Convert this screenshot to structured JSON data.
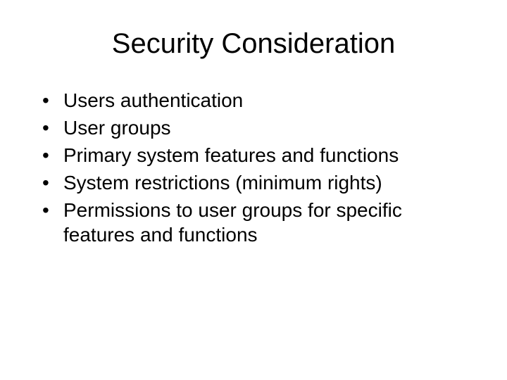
{
  "slide": {
    "title": "Security Consideration",
    "bullets": [
      "Users authentication",
      "User groups",
      "Primary system features and functions",
      "System restrictions (minimum rights)",
      "Permissions to user groups for specific features and functions"
    ]
  }
}
